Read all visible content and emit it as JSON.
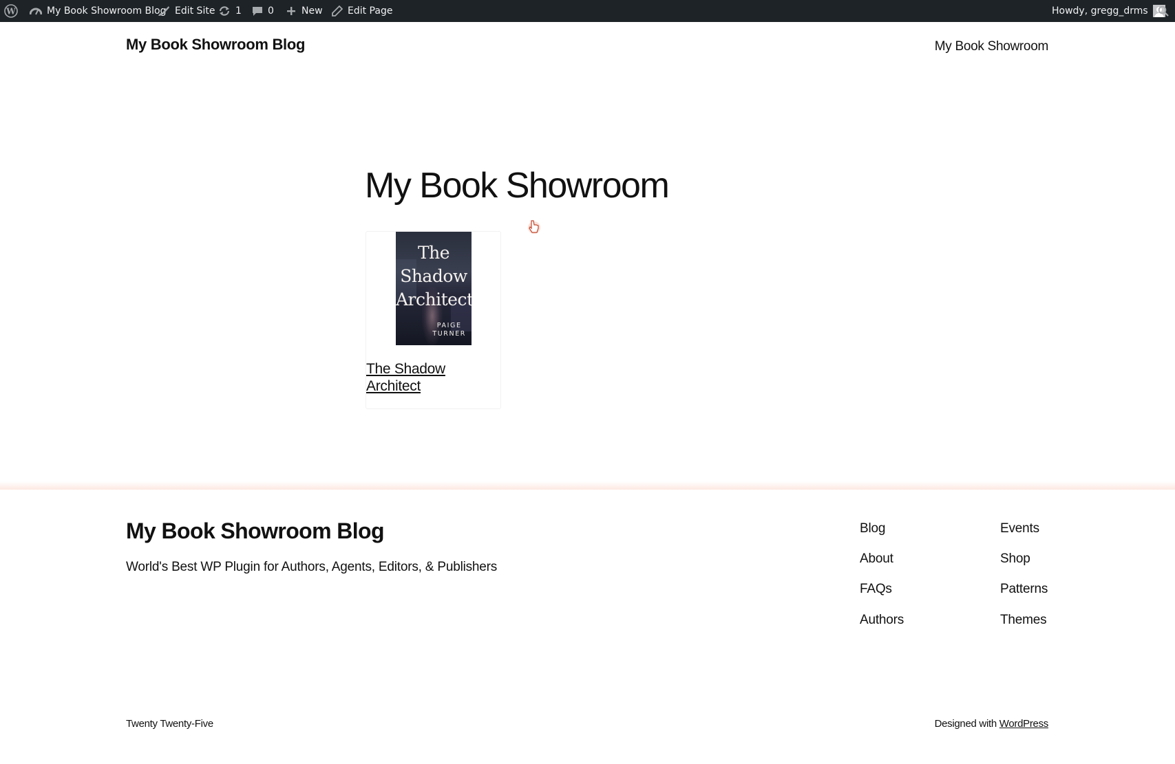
{
  "admin_bar": {
    "site_name": "My Book Showroom Blog",
    "edit_site": "Edit Site",
    "updates_count": "1",
    "comments_count": "0",
    "new_label": "New",
    "edit_page": "Edit Page",
    "howdy": "Howdy, gregg_drms"
  },
  "header": {
    "site_title": "My Book Showroom Blog",
    "nav_item": "My Book Showroom"
  },
  "main": {
    "page_title": "My Book Showroom",
    "books": [
      {
        "cover_title_lines": [
          "The",
          "Shadow",
          "Architect"
        ],
        "cover_author_lines": [
          "PAIGE",
          "TURNER"
        ],
        "title": "The Shadow Architect"
      }
    ]
  },
  "footer": {
    "site_title": "My Book Showroom Blog",
    "tagline": "World's Best WP Plugin for Authors, Agents, Editors, & Publishers",
    "nav_col1": [
      "Blog",
      "About",
      "FAQs",
      "Authors"
    ],
    "nav_col2": [
      "Events",
      "Shop",
      "Patterns",
      "Themes"
    ],
    "theme_credit": "Twenty Twenty-Five",
    "designed_with": "Designed with",
    "wordpress_link": "WordPress"
  },
  "colors": {
    "admin_bar_bg": "#1d2327",
    "text": "#111111",
    "footer_glow": "#fde6de"
  }
}
